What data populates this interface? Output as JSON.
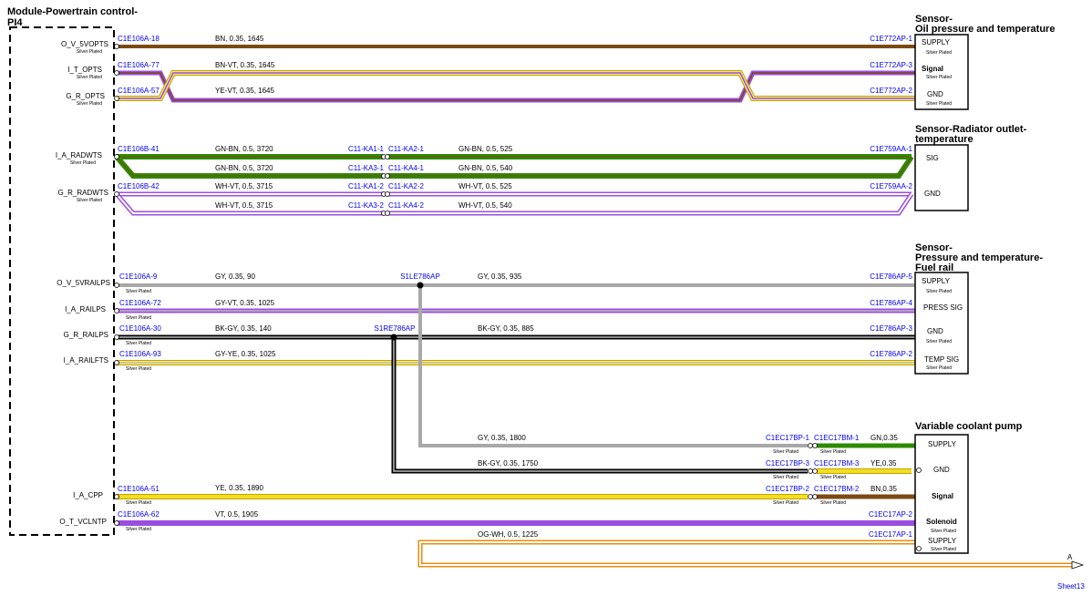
{
  "module": {
    "title": "Module-Powertrain control-",
    "subtitle": "PI4",
    "pins": [
      {
        "name": "O_V_5VOPTS",
        "plating": "Silver Plated"
      },
      {
        "name": "I_T_OPTS",
        "plating": "Silver Plated"
      },
      {
        "name": "G_R_OPTS",
        "plating": "Silver Plated"
      },
      {
        "name": "I_A_RADWTS",
        "plating": "Silver Plated"
      },
      {
        "name": "G_R_RADWTS",
        "plating": "Silver Plated"
      },
      {
        "name": "O_V_5VRAILPS",
        "plating": ""
      },
      {
        "name": "I_A_RAILPS",
        "plating": ""
      },
      {
        "name": "G_R_RAILPS",
        "plating": ""
      },
      {
        "name": "I_A_RAILFTS",
        "plating": ""
      },
      {
        "name": "I_A_CPP",
        "plating": ""
      },
      {
        "name": "O_T_VCLNTP",
        "plating": ""
      }
    ]
  },
  "colors": {
    "BN": "#7b4a12",
    "VT": "#9b4de0",
    "YE": "#f0e020",
    "YE_OUTLINE": "#c8a000",
    "GN": "#2e8b00",
    "GN_OUTLINE": "#1f5f00",
    "WH": "#ffffff",
    "GY": "#a8a8a8",
    "BK": "#000000",
    "OG": "#e88c10",
    "LINK": "#0000ee"
  },
  "sensors": [
    {
      "title": "Sensor-",
      "title2": "Oil pressure and temperature",
      "pins": [
        {
          "label": "SUPPLY",
          "plating": "Silver Plated",
          "bold": false
        },
        {
          "label": "Signal",
          "plating": "Silver Plated",
          "bold": true
        },
        {
          "label": "GND",
          "plating": "Silver Plated",
          "bold": false
        }
      ]
    },
    {
      "title": "Sensor-Radiator outlet-",
      "title2": "temperature",
      "pins": [
        {
          "label": "SIG",
          "plating": "",
          "bold": false
        },
        {
          "label": "GND",
          "plating": "",
          "bold": false
        }
      ]
    },
    {
      "title": "Sensor-",
      "title2": "Pressure and temperature-",
      "title3": "Fuel rail",
      "pins": [
        {
          "label": "SUPPLY",
          "plating": "Silver Plated",
          "bold": false
        },
        {
          "label": "PRESS SIG",
          "plating": "",
          "bold": false
        },
        {
          "label": "GND",
          "plating": "Silver Plated",
          "bold": false
        },
        {
          "label": "TEMP SIG",
          "plating": "Silver Plated",
          "bold": false
        }
      ]
    },
    {
      "title": "Variable coolant pump",
      "pins": [
        {
          "label": "SUPPLY",
          "plating": "",
          "bold": false
        },
        {
          "label": "GND",
          "plating": "",
          "bold": false
        },
        {
          "label": "Signal",
          "plating": "",
          "bold": true
        },
        {
          "label": "Solenoid",
          "plating": "Silver Plated",
          "bold": true
        },
        {
          "label": "SUPPLY",
          "plating": "Silver Plated",
          "bold": false
        }
      ]
    }
  ],
  "wires": [
    {
      "id": "w1",
      "from": "C1E106A-18",
      "to": "C1E772AP-1",
      "spec": "BN,  0.35,  1645"
    },
    {
      "id": "w2",
      "from": "C1E106A-77",
      "to": "C1E772AP-3",
      "spec": "BN-VT,  0.35,  1645"
    },
    {
      "id": "w3",
      "from": "C1E106A-57",
      "to": "C1E772AP-2",
      "spec": "YE-VT,  0.35,  1645"
    },
    {
      "id": "w4",
      "from": "C1E106B-41",
      "spec": "GN-BN,  0.5,  3720",
      "splice_in": "C11-KA1-1",
      "splice_out": "C11-KA2-1",
      "spec2": "GN-BN,  0.5,  525",
      "to": "C1E759AA-1"
    },
    {
      "id": "w5",
      "spec": "GN-BN,  0.5,  3720",
      "splice_in": "C11-KA3-1",
      "splice_out": "C11-KA4-1",
      "spec2": "GN-BN,  0.5,  540"
    },
    {
      "id": "w6",
      "from": "C1E106B-42",
      "spec": "WH-VT,  0.5,  3715",
      "splice_in": "C11-KA1-2",
      "splice_out": "C11-KA2-2",
      "spec2": "WH-VT,  0.5,  525",
      "to": "C1E759AA-2"
    },
    {
      "id": "w7",
      "spec": "WH-VT,  0.5,  3715",
      "splice_in": "C11-KA3-2",
      "splice_out": "C11-KA4-2",
      "spec2": "WH-VT,  0.5,  540"
    },
    {
      "id": "w8",
      "from": "C1E106A-9",
      "spec": "GY,  0.35,  90",
      "splice": "S1LE786AP",
      "spec2": "GY,  0.35,  935",
      "to": "C1E786AP-5"
    },
    {
      "id": "w9",
      "from": "C1E106A-72",
      "spec": "GY-VT,  0.35,  1025",
      "to": "C1E786AP-4"
    },
    {
      "id": "w10",
      "from": "C1E106A-30",
      "spec": "BK-GY,  0.35,  140",
      "splice": "S1RE786AP",
      "spec2": "BK-GY,  0.35,  885",
      "to": "C1E786AP-3"
    },
    {
      "id": "w11",
      "from": "C1E106A-93",
      "spec": "GY-YE,  0.35,  1025",
      "to": "C1E786AP-2"
    },
    {
      "id": "w12",
      "spec": "GY,  0.35,  1800",
      "conn_a": "C1EC17BP-1",
      "conn_b": "C1EC17BM-1",
      "spec2": "GN,0.35"
    },
    {
      "id": "w13",
      "spec": "BK-GY,  0.35,  1750",
      "conn_a": "C1EC17BP-3",
      "conn_b": "C1EC17BM-3",
      "spec2": "YE,0.35"
    },
    {
      "id": "w14",
      "from": "C1E106A-51",
      "spec": "YE,  0.35,  1890",
      "conn_a": "C1EC17BP-2",
      "conn_b": "C1EC17BM-2",
      "spec2": "BN,0.35"
    },
    {
      "id": "w15",
      "from": "C1E106A-62",
      "spec": "VT,  0.5,  1905",
      "to": "C1EC17AP-2"
    },
    {
      "id": "w16",
      "spec": "OG-WH,  0.5,  1225",
      "to": "C1EC17AP-1"
    }
  ],
  "connector_plating": "Silver Plated",
  "offpage": {
    "letter": "A",
    "sheet": "Sheet13"
  }
}
